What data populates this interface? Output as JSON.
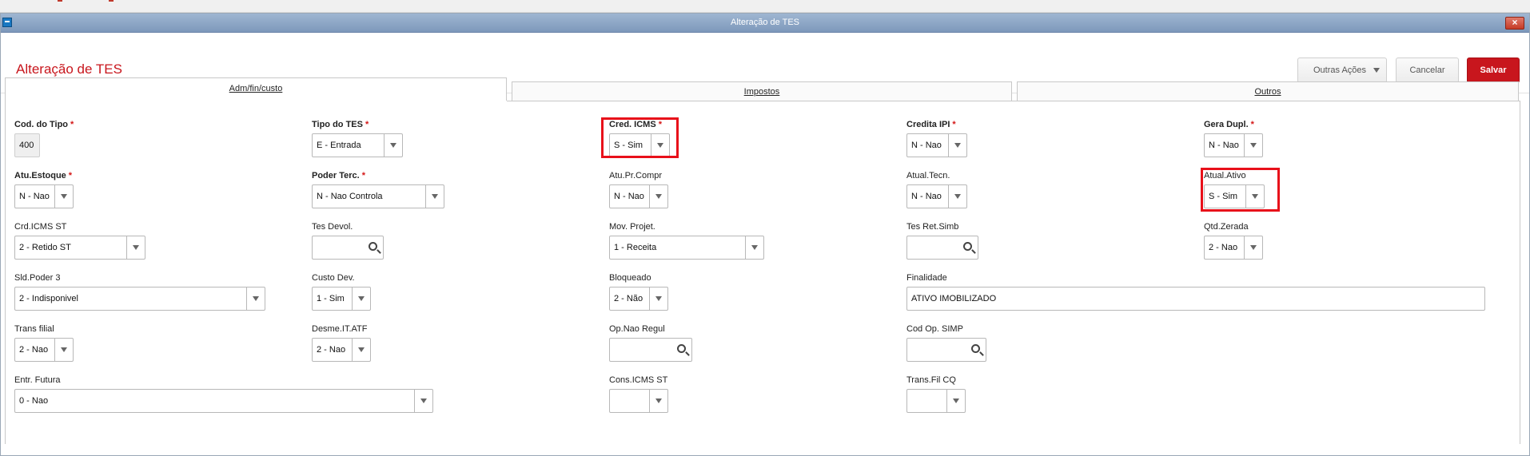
{
  "dialog": {
    "title": "Alteração de TES",
    "close_glyph": "×"
  },
  "header": {
    "page_title": "Alteração de TES",
    "buttons": {
      "outras": "Outras Ações",
      "cancelar": "Cancelar",
      "salvar": "Salvar"
    }
  },
  "tabs": [
    {
      "label": "Adm/fin/custo"
    },
    {
      "label": "Impostos"
    },
    {
      "label": "Outros"
    }
  ],
  "fields": {
    "cod_tipo": {
      "label": "Cod. do Tipo",
      "value": "400"
    },
    "tipo_tes": {
      "label": "Tipo do TES",
      "value": "E - Entrada"
    },
    "cred_icms": {
      "label": "Cred. ICMS",
      "value": "S - Sim"
    },
    "credita_ipi": {
      "label": "Credita IPI",
      "value": "N - Nao"
    },
    "gera_dupl": {
      "label": "Gera Dupl.",
      "value": "N - Nao"
    },
    "atu_estoque": {
      "label": "Atu.Estoque",
      "value": "N - Nao"
    },
    "poder_terc": {
      "label": "Poder Terc.",
      "value": "N - Nao Controla"
    },
    "atu_pr_compr": {
      "label": "Atu.Pr.Compr",
      "value": "N - Nao"
    },
    "atual_tecn": {
      "label": "Atual.Tecn.",
      "value": "N - Nao"
    },
    "atual_ativo": {
      "label": "Atual.Ativo",
      "value": "S - Sim"
    },
    "crd_icms_st": {
      "label": "Crd.ICMS ST",
      "value": "2 - Retido ST"
    },
    "tes_devol": {
      "label": "Tes Devol.",
      "value": ""
    },
    "mov_projet": {
      "label": "Mov. Projet.",
      "value": "1 - Receita"
    },
    "tes_ret_simb": {
      "label": "Tes Ret.Simb",
      "value": ""
    },
    "qtd_zerada": {
      "label": "Qtd.Zerada",
      "value": "2 - Nao"
    },
    "sld_poder3": {
      "label": "Sld.Poder 3",
      "value": "2 - Indisponivel"
    },
    "custo_dev": {
      "label": "Custo Dev.",
      "value": "1 - Sim"
    },
    "bloqueado": {
      "label": "Bloqueado",
      "value": "2 - Não"
    },
    "finalidade": {
      "label": "Finalidade",
      "value": "ATIVO IMOBILIZADO"
    },
    "trans_filial": {
      "label": "Trans filial",
      "value": "2 - Nao"
    },
    "desme_it_atf": {
      "label": "Desme.IT.ATF",
      "value": "2 - Nao"
    },
    "op_nao_regul": {
      "label": "Op.Nao Regul",
      "value": ""
    },
    "cod_op_simp": {
      "label": "Cod Op. SIMP",
      "value": ""
    },
    "entr_futura": {
      "label": "Entr. Futura",
      "value": "0 - Nao"
    },
    "cons_icms_st": {
      "label": "Cons.ICMS ST",
      "value": ""
    },
    "trans_fil_cq": {
      "label": "Trans.Fil CQ",
      "value": ""
    }
  },
  "required_mark": "*"
}
